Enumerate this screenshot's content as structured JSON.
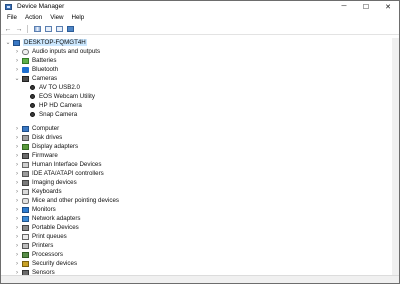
{
  "window": {
    "title": "Device Manager"
  },
  "window_controls": {
    "minimize": "─",
    "maximize": "☐",
    "close": "✕"
  },
  "menu": {
    "items": [
      "File",
      "Action",
      "View",
      "Help"
    ]
  },
  "toolbar": {
    "back_glyph": "←",
    "forward_glyph": "→"
  },
  "tree": {
    "root_label": "DESKTOP-FQMGT4H",
    "expand_glyph": "›",
    "collapse_glyph": "⌄",
    "items": [
      {
        "label": "Audio inputs and outputs",
        "icon": "audio-icon"
      },
      {
        "label": "Batteries",
        "icon": "battery-icon"
      },
      {
        "label": "Bluetooth",
        "icon": "bluetooth-icon"
      },
      {
        "label": "Cameras",
        "icon": "camera-icon",
        "expanded": true,
        "children": [
          "AV TO USB2.0",
          "EOS Webcam Utility",
          "HP HD Camera",
          "Snap Camera"
        ]
      },
      {
        "label": "Computer",
        "icon": "computer-icon"
      },
      {
        "label": "Disk drives",
        "icon": "disk-drive-icon"
      },
      {
        "label": "Display adapters",
        "icon": "display-adapter-icon"
      },
      {
        "label": "Firmware",
        "icon": "firmware-icon"
      },
      {
        "label": "Human Interface Devices",
        "icon": "hid-icon"
      },
      {
        "label": "IDE ATA/ATAPI controllers",
        "icon": "ide-controller-icon"
      },
      {
        "label": "Imaging devices",
        "icon": "imaging-device-icon"
      },
      {
        "label": "Keyboards",
        "icon": "keyboard-icon"
      },
      {
        "label": "Mice and other pointing devices",
        "icon": "mouse-icon"
      },
      {
        "label": "Monitors",
        "icon": "monitor-icon"
      },
      {
        "label": "Network adapters",
        "icon": "network-adapter-icon"
      },
      {
        "label": "Portable Devices",
        "icon": "portable-device-icon"
      },
      {
        "label": "Print queues",
        "icon": "print-queue-icon"
      },
      {
        "label": "Printers",
        "icon": "printer-icon"
      },
      {
        "label": "Processors",
        "icon": "processor-icon"
      },
      {
        "label": "Security devices",
        "icon": "security-device-icon"
      },
      {
        "label": "Sensors",
        "icon": "sensor-icon"
      }
    ]
  }
}
